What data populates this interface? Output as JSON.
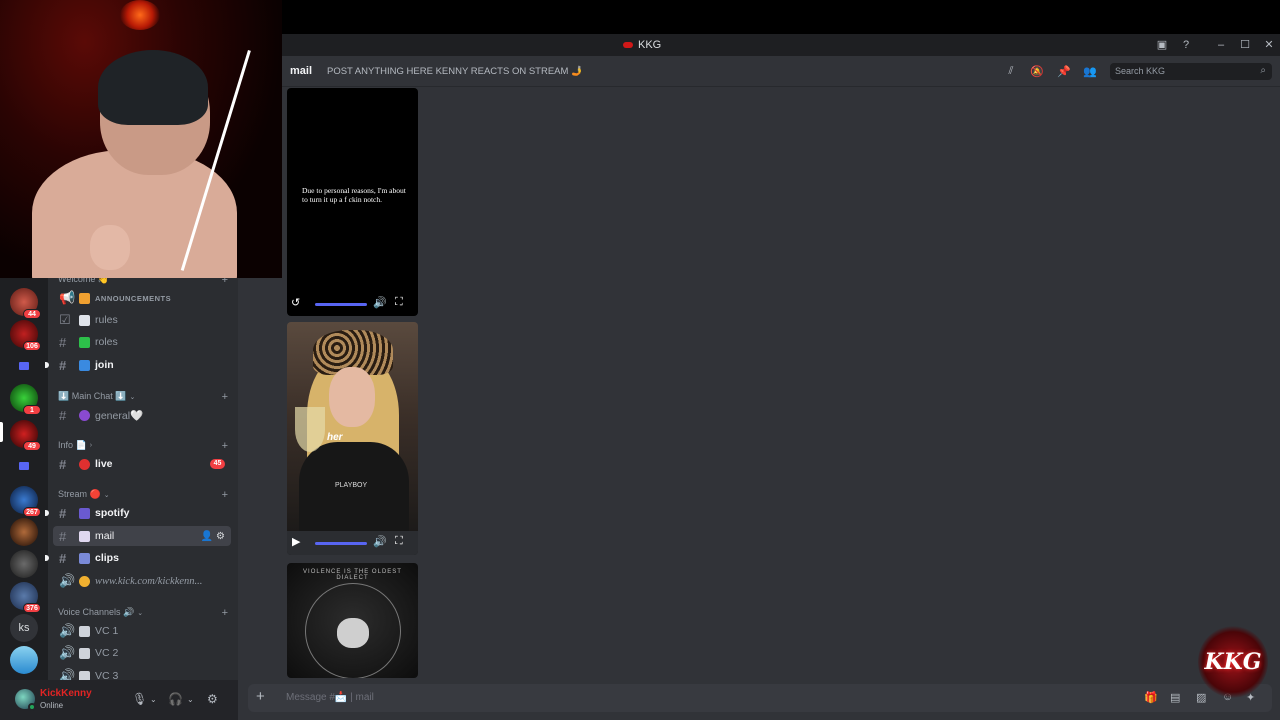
{
  "app": {
    "title": "KKG"
  },
  "header": {
    "channel_name": "mail",
    "topic": "POST ANYTHING HERE KENNY REACTS ON STREAM 🤳",
    "search_placeholder": "Search KKG"
  },
  "servers": [
    {
      "badge": "44"
    },
    {
      "badge": "106"
    },
    {
      "badge": ""
    },
    {
      "badge": "1"
    },
    {
      "badge": "49"
    },
    {
      "badge": ""
    },
    {
      "badge": "267"
    },
    {
      "badge": ""
    },
    {
      "badge": ""
    },
    {
      "badge": "376"
    },
    {
      "label": "ks"
    },
    {
      "badge": ""
    }
  ],
  "sidebar": {
    "categories": {
      "welcome": "Welcome 👋",
      "main_chat": "⬇️ Main Chat ⬇️",
      "info": "Info 📄",
      "stream": "Stream 🔴",
      "voice": "Voice Channels 🔊"
    },
    "channels": {
      "announcements": "ANNOUNCEMENTS",
      "rules": "rules",
      "roles": "roles",
      "join": "join",
      "general": "general🤍",
      "live": "live",
      "live_count": "45",
      "spotify": "spotify",
      "mail": "mail",
      "clips": "clips",
      "kick_link": "www.kick.com/kickkenn...",
      "vc1": "VC 1",
      "vc2": "VC 2",
      "vc3": "VC 3"
    }
  },
  "user": {
    "name": "KickKenny",
    "status": "Online"
  },
  "messages": {
    "video1_caption": "Due to personal reasons, I'm about to turn it up a f ckin notch.",
    "video2_overlay_word": "her",
    "video2_shirt_text": "PLAYBOY",
    "image3_text": "VIOLENCE IS THE OLDEST DIALECT"
  },
  "composer": {
    "placeholder": "Message #📩 | mail"
  },
  "overlay": {
    "logo_text": "KKG"
  },
  "colors": {
    "accent": "#5865f2",
    "danger": "#f23f43",
    "online": "#23a55a",
    "username": "#e02424"
  }
}
